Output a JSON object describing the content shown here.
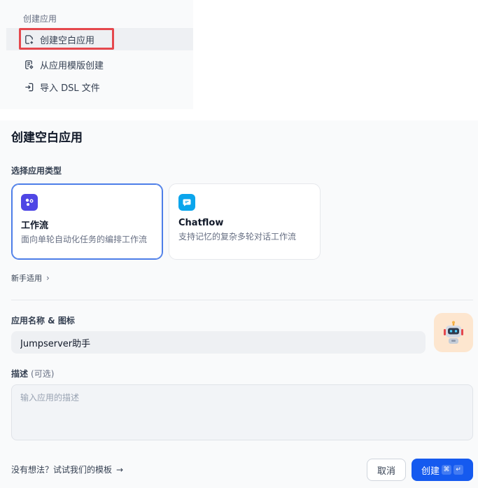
{
  "menu": {
    "title": "创建应用",
    "items": [
      {
        "label": "创建空白应用",
        "icon": "blank-app-icon",
        "active": true
      },
      {
        "label": "从应用模版创建",
        "icon": "template-file-icon",
        "active": false
      },
      {
        "label": "导入 DSL 文件",
        "icon": "import-icon",
        "active": false
      }
    ]
  },
  "dialog": {
    "title": "创建空白应用",
    "type_section_label": "选择应用类型",
    "types": [
      {
        "name": "工作流",
        "desc": "面向单轮自动化任务的编排工作流",
        "icon": "workflow-icon",
        "color": "#4f46e5",
        "selected": true
      },
      {
        "name": "Chatflow",
        "desc": "支持记忆的复杂多轮对话工作流",
        "icon": "chatflow-icon",
        "color": "#0ba5ec",
        "selected": false
      }
    ],
    "beginner_label": "新手适用",
    "name_section_label": "应用名称 & 图标",
    "name_value": "Jumpserver助手",
    "app_icon": "robot-icon",
    "desc_label": "描述",
    "desc_optional": "(可选)",
    "desc_placeholder": "输入应用的描述",
    "template_hint": "没有想法？试试我们的模板",
    "cancel_label": "取消",
    "create_label": "创建",
    "create_shortcut": [
      "⌘",
      "↵"
    ]
  },
  "colors": {
    "primary": "#155aef",
    "highlight_box": "#e5484d",
    "selected_border": "#4d7ee8"
  }
}
